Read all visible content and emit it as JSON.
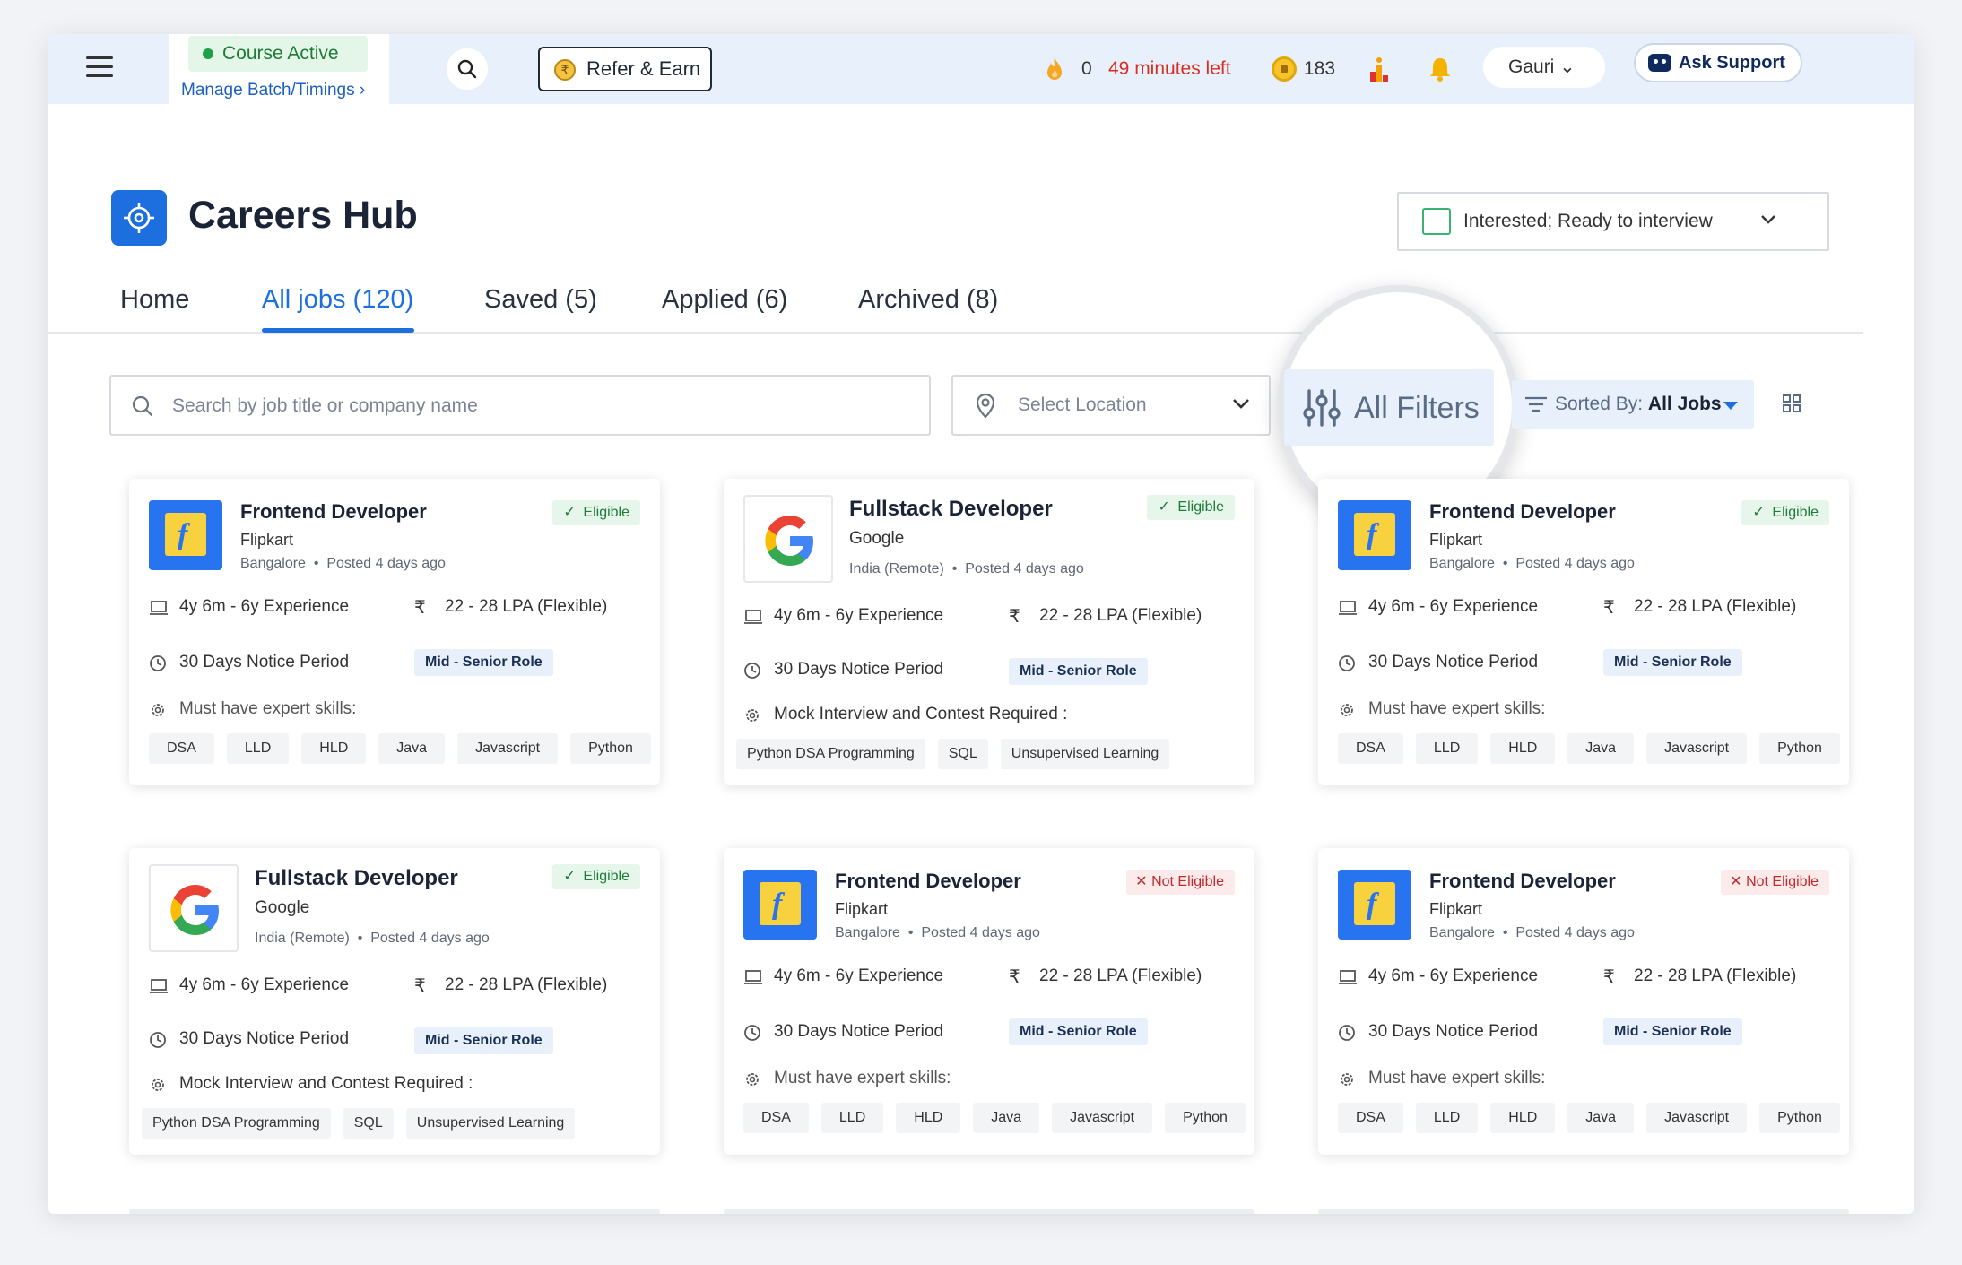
{
  "topbar": {
    "course_status": "Course Active",
    "manage_batch": "Manage Batch/Timings ›",
    "refer_earn": "Refer & Earn",
    "refer_icon": "₹",
    "streak_count": "0",
    "time_left": "49 minutes left",
    "coins": "183",
    "user_name": "Gauri ⌄",
    "ask_support": "Ask Support"
  },
  "page": {
    "title": "Careers Hub",
    "status": "Interested; Ready to interview"
  },
  "tabs": [
    {
      "label": "Home",
      "active": false
    },
    {
      "label": "All jobs (120)",
      "active": true
    },
    {
      "label": "Saved (5)",
      "active": false
    },
    {
      "label": "Applied (6)",
      "active": false
    },
    {
      "label": "Archived (8)",
      "active": false
    }
  ],
  "filters": {
    "search_placeholder": "Search by job title or company name",
    "location_placeholder": "Select Location",
    "all_filters": "All Filters",
    "sorted_by_label": "Sorted By:",
    "sorted_by_value": "All Jobs"
  },
  "cards": [
    {
      "title": "Frontend Developer",
      "company": "Flipkart",
      "location": "Bangalore",
      "posted": "Posted 4 days ago",
      "eligibility": "Eligible",
      "experience": "4y 6m - 6y Experience",
      "salary": "22 - 28 LPA (Flexible)",
      "notice": "30 Days Notice Period",
      "role": "Mid - Senior Role",
      "skills_label": "Must have expert skills:",
      "skills": [
        "DSA",
        "LLD",
        "HLD",
        "Java",
        "Javascript",
        "Python"
      ]
    },
    {
      "title": "Fullstack Developer",
      "company": "Google",
      "location": "India (Remote)",
      "posted": "Posted 4 days ago",
      "eligibility": "Eligible",
      "experience": "4y 6m - 6y Experience",
      "salary": "22 - 28 LPA (Flexible)",
      "notice": "30 Days Notice Period",
      "role": "Mid - Senior Role",
      "skills_label": "Mock Interview and Contest  Required :",
      "skills": [
        "Python DSA Programming",
        "SQL",
        "Unsupervised Learning"
      ]
    },
    {
      "title": "Frontend Developer",
      "company": "Flipkart",
      "location": "Bangalore",
      "posted": "Posted 4 days ago",
      "eligibility": "Eligible",
      "experience": "4y 6m - 6y Experience",
      "salary": "22 - 28 LPA (Flexible)",
      "notice": "30 Days Notice Period",
      "role": "Mid - Senior Role",
      "skills_label": "Must have expert skills:",
      "skills": [
        "DSA",
        "LLD",
        "HLD",
        "Java",
        "Javascript",
        "Python"
      ]
    },
    {
      "title": "Fullstack Developer",
      "company": "Google",
      "location": "India (Remote)",
      "posted": "Posted 4 days ago",
      "eligibility": "Eligible",
      "experience": "4y 6m - 6y Experience",
      "salary": "22 - 28 LPA (Flexible)",
      "notice": "30 Days Notice Period",
      "role": "Mid - Senior Role",
      "skills_label": "Mock Interview and Contest  Required :",
      "skills": [
        "Python DSA Programming",
        "SQL",
        "Unsupervised Learning"
      ]
    },
    {
      "title": "Frontend Developer",
      "company": "Flipkart",
      "location": "Bangalore",
      "posted": "Posted 4 days ago",
      "eligibility": "Not Eligible",
      "experience": "4y 6m - 6y Experience",
      "salary": "22 - 28 LPA (Flexible)",
      "notice": "30 Days Notice Period",
      "role": "Mid - Senior Role",
      "skills_label": "Must have expert skills:",
      "skills": [
        "DSA",
        "LLD",
        "HLD",
        "Java",
        "Javascript",
        "Python"
      ]
    },
    {
      "title": "Frontend Developer",
      "company": "Flipkart",
      "location": "Bangalore",
      "posted": "Posted 4 days ago",
      "eligibility": "Not Eligible",
      "experience": "4y 6m - 6y Experience",
      "salary": "22 - 28 LPA (Flexible)",
      "notice": "30 Days Notice Period",
      "role": "Mid - Senior Role",
      "skills_label": "Must have expert skills:",
      "skills": [
        "DSA",
        "LLD",
        "HLD",
        "Java",
        "Javascript",
        "Python"
      ]
    }
  ],
  "colors": {
    "accent": "#1d6fe0",
    "topbar_bg": "#e8f1fb",
    "eligible": "#1e7b3a",
    "not_eligible": "#c02a2a",
    "time_left": "#d92d20"
  }
}
